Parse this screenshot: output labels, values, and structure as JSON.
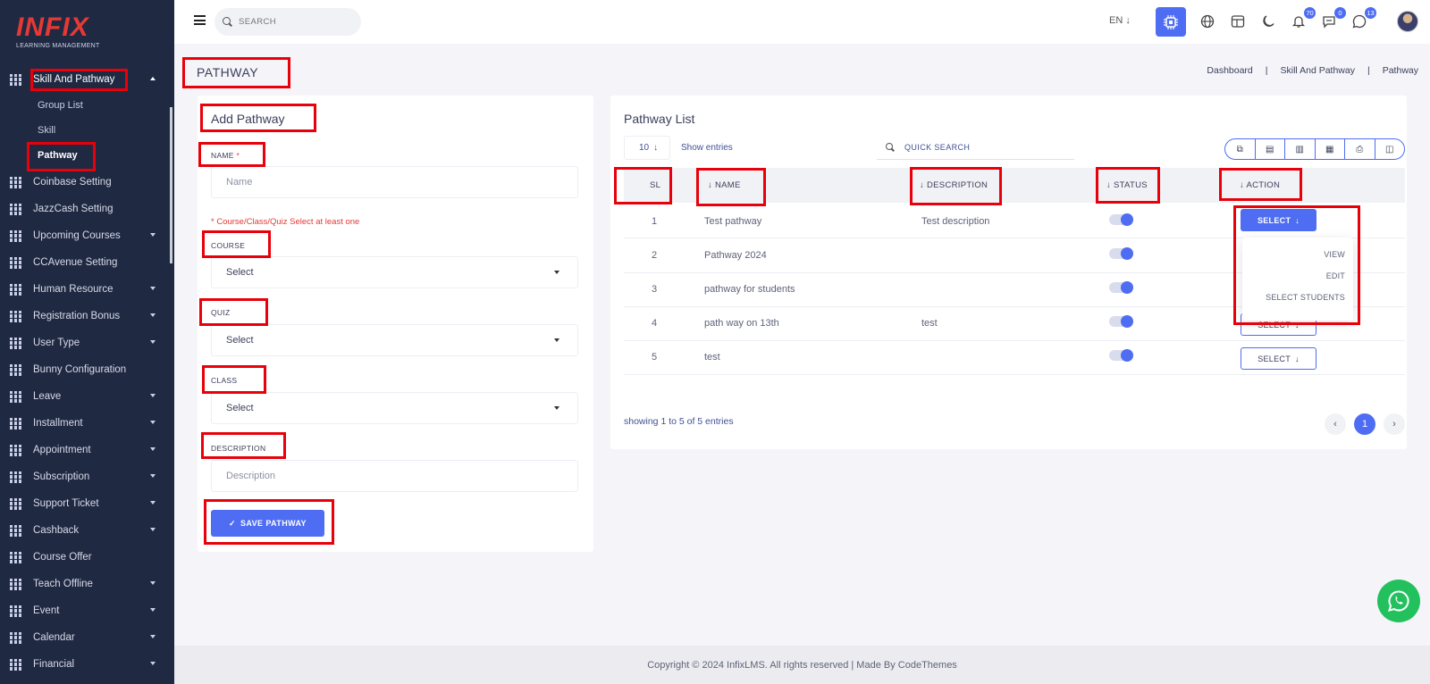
{
  "brand": {
    "name": "INFIX",
    "tagline": "LEARNING MANAGEMENT"
  },
  "header": {
    "search_placeholder": "SEARCH",
    "language": "EN",
    "notifications_count": "70",
    "messages_count": "0",
    "whatsapp_count": "13"
  },
  "sidebar": {
    "items": [
      {
        "label": "Skill And Pathway",
        "expanded": true
      },
      {
        "label": "Coinbase Setting"
      },
      {
        "label": "JazzCash Setting"
      },
      {
        "label": "Upcoming Courses"
      },
      {
        "label": "CCAvenue Setting"
      },
      {
        "label": "Human Resource"
      },
      {
        "label": "Registration Bonus"
      },
      {
        "label": "User Type"
      },
      {
        "label": "Bunny Configuration"
      },
      {
        "label": "Leave"
      },
      {
        "label": "Installment"
      },
      {
        "label": "Appointment"
      },
      {
        "label": "Subscription"
      },
      {
        "label": "Support Ticket"
      },
      {
        "label": "Cashback"
      },
      {
        "label": "Course Offer"
      },
      {
        "label": "Teach Offline"
      },
      {
        "label": "Event"
      },
      {
        "label": "Calendar"
      },
      {
        "label": "Financial"
      }
    ],
    "sub_items": [
      {
        "label": "Group List"
      },
      {
        "label": "Skill"
      },
      {
        "label": "Pathway",
        "active": true
      }
    ]
  },
  "page": {
    "title": "PATHWAY",
    "breadcrumb": [
      "Dashboard",
      "|",
      "Skill And Pathway",
      "|",
      "Pathway"
    ]
  },
  "form": {
    "title": "Add Pathway",
    "name_label": "NAME",
    "required_mark": "*",
    "name_placeholder": "Name",
    "note": "* Course/Class/Quiz Select at least one",
    "course_label": "COURSE",
    "course_value": "Select",
    "quiz_label": "QUIZ",
    "quiz_value": "Select",
    "class_label": "CLASS",
    "class_value": "Select",
    "description_label": "DESCRIPTION",
    "description_placeholder": "Description",
    "save_label": "SAVE PATHWAY"
  },
  "list": {
    "title": "Pathway List",
    "entries_value": "10",
    "show_entries": "Show entries",
    "quick_search": "QUICK SEARCH",
    "columns": [
      "SL",
      "NAME",
      "DESCRIPTION",
      "STATUS",
      "ACTION"
    ],
    "rows": [
      {
        "sl": "1",
        "name": "Test pathway",
        "description": "Test description",
        "status": true,
        "action": "SELECT"
      },
      {
        "sl": "2",
        "name": "Pathway 2024",
        "description": "",
        "status": true,
        "action": "SELECT"
      },
      {
        "sl": "3",
        "name": "pathway for students",
        "description": "",
        "status": true,
        "action": "SELECT"
      },
      {
        "sl": "4",
        "name": "path way on 13th",
        "description": "test",
        "status": true,
        "action": "SELECT"
      },
      {
        "sl": "5",
        "name": "test",
        "description": "",
        "status": true,
        "action": "SELECT"
      }
    ],
    "action_menu": [
      "VIEW",
      "EDIT",
      "SELECT STUDENTS"
    ],
    "showing": "showing 1 to 5 of 5 entries",
    "current_page": "1"
  },
  "footer": {
    "text": "Copyright © 2024 InfixLMS. All rights reserved | Made By CodeThemes"
  },
  "colors": {
    "accent": "#4e6df2",
    "sidebar": "#202942",
    "annotation": "#e8000b",
    "whatsapp": "#22c15e"
  }
}
